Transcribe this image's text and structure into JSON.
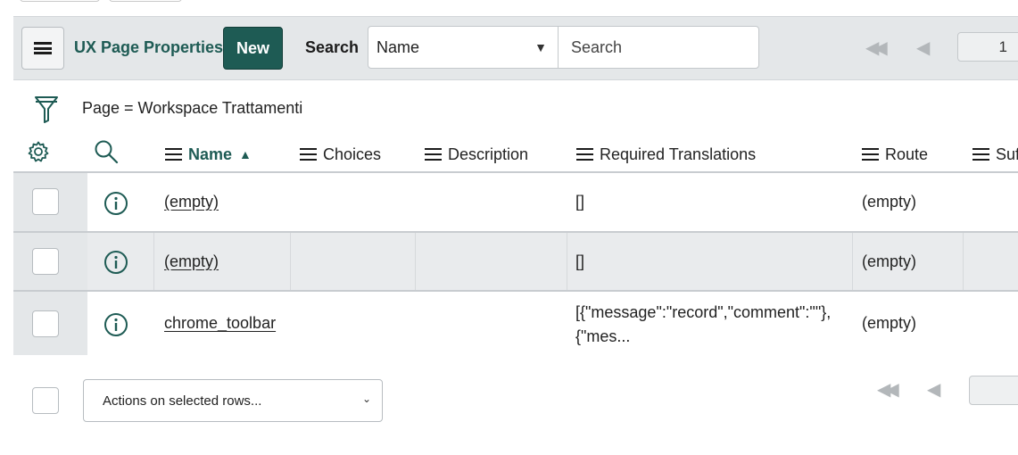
{
  "header": {
    "title": "UX Page Properties",
    "new_label": "New",
    "search_label": "Search",
    "search_field_value": "Name",
    "search_placeholder": "Search",
    "page_number": "1"
  },
  "filter": {
    "breadcrumb": "Page = Workspace Trattamenti"
  },
  "columns": [
    {
      "label": "Name",
      "sorted": "ascending"
    },
    {
      "label": "Choices"
    },
    {
      "label": "Description"
    },
    {
      "label": "Required Translations"
    },
    {
      "label": "Route"
    },
    {
      "label": "Suf"
    }
  ],
  "rows": [
    {
      "name": "(empty)",
      "choices": "",
      "description": "",
      "required_translations": "[]",
      "required_translations_2": "",
      "route": "(empty)"
    },
    {
      "name": "(empty)",
      "choices": "",
      "description": "",
      "required_translations": "[]",
      "required_translations_2": "",
      "route": "(empty)"
    },
    {
      "name": "chrome_toolbar",
      "choices": "",
      "description": "",
      "required_translations": "[{\"message\":\"record\",\"comment\":\"\"},",
      "required_translations_2": "{\"mes...",
      "route": "(empty)"
    }
  ],
  "footer": {
    "actions_placeholder": "Actions on selected rows..."
  },
  "colors": {
    "accent": "#1e5b54",
    "header_bg": "#e4e7e9",
    "row_alt": "#e9ebed"
  },
  "icons": [
    "hamburger-menu-icon",
    "filter-funnel-icon",
    "gear-icon",
    "magnifier-icon",
    "info-icon",
    "first-page-icon",
    "previous-page-icon"
  ]
}
